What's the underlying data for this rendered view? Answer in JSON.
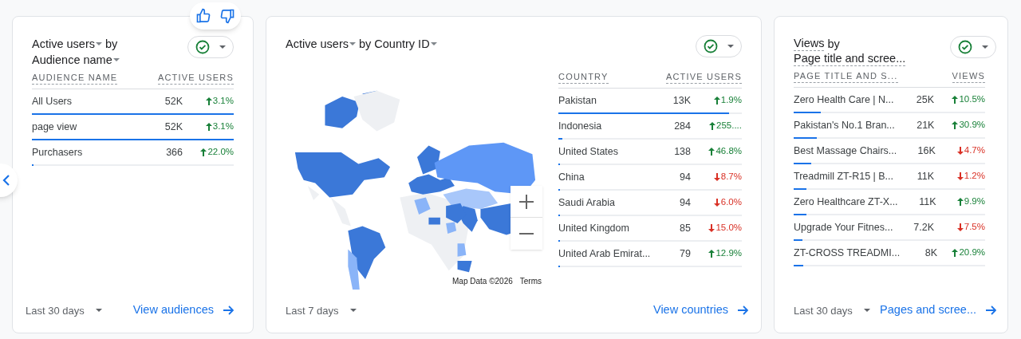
{
  "audience_card": {
    "title": [
      [
        {
          "text": "Active users",
          "kind": "dropdown"
        },
        {
          "text": "by",
          "kind": "plain"
        }
      ],
      [
        {
          "text": "Audience name",
          "kind": "dropdown"
        }
      ]
    ],
    "columns": [
      "AUDIENCE NAME",
      "ACTIVE USERS"
    ],
    "rows": [
      {
        "label": "All Users",
        "value": "52K",
        "change": "3.1%",
        "rising": true,
        "level": 1.0
      },
      {
        "label": "page view",
        "value": "52K",
        "change": "3.1%",
        "rising": true,
        "level": 1.0
      },
      {
        "label": "Purchasers",
        "value": "366",
        "change": "22.0%",
        "rising": true,
        "level": 0.008
      }
    ],
    "date_range": "Last 30 days",
    "link": "View audiences"
  },
  "country_card": {
    "title": [
      [
        {
          "text": "Active users",
          "kind": "dropdown"
        },
        {
          "text": "by",
          "kind": "plain"
        },
        {
          "text": "Country ID",
          "kind": "dropdown"
        }
      ]
    ],
    "map": {
      "attribution": "Map Data ©2026",
      "terms": "Terms"
    },
    "columns": [
      "COUNTRY",
      "ACTIVE USERS"
    ],
    "rows": [
      {
        "label": "Pakistan",
        "value": "13K",
        "change": "1.9%",
        "rising": true,
        "level": 0.93
      },
      {
        "label": "Indonesia",
        "value": "284",
        "change": "255....",
        "rising": true,
        "level": 0.02
      },
      {
        "label": "United States",
        "value": "138",
        "change": "46.8%",
        "rising": true,
        "level": 0.01
      },
      {
        "label": "China",
        "value": "94",
        "change": "8.7%",
        "rising": false,
        "level": 0.007
      },
      {
        "label": "Saudi Arabia",
        "value": "94",
        "change": "6.0%",
        "rising": false,
        "level": 0.007
      },
      {
        "label": "United Kingdom",
        "value": "85",
        "change": "15.0%",
        "rising": false,
        "level": 0.006
      },
      {
        "label": "United Arab Emirat...",
        "value": "79",
        "change": "12.9%",
        "rising": true,
        "level": 0.006
      }
    ],
    "date_range": "Last 7 days",
    "link": "View countries"
  },
  "pages_card": {
    "title": [
      [
        {
          "text": "Views",
          "kind": "dashed"
        },
        {
          "text": "by",
          "kind": "plain"
        }
      ],
      [
        {
          "text": "Page title and scree...",
          "kind": "dashed"
        }
      ]
    ],
    "columns": [
      "PAGE TITLE AND S...",
      "VIEWS"
    ],
    "rows": [
      {
        "label": "Zero Health Care | N...",
        "value": "25K",
        "change": "10.5%",
        "rising": true,
        "level": 0.14
      },
      {
        "label": "Pakistan's No.1 Bran...",
        "value": "21K",
        "change": "30.9%",
        "rising": true,
        "level": 0.12
      },
      {
        "label": "Best Massage Chairs...",
        "value": "16K",
        "change": "4.7%",
        "rising": false,
        "level": 0.09
      },
      {
        "label": "Treadmill ZT-R15 | B...",
        "value": "11K",
        "change": "1.2%",
        "rising": false,
        "level": 0.065
      },
      {
        "label": "Zero Healthcare ZT-X...",
        "value": "11K",
        "change": "9.9%",
        "rising": true,
        "level": 0.065
      },
      {
        "label": "Upgrade Your Fitnes...",
        "value": "7.2K",
        "change": "7.5%",
        "rising": false,
        "level": 0.045
      },
      {
        "label": "ZT-CROSS TREADMI...",
        "value": "8K",
        "change": "20.9%",
        "rising": true,
        "level": 0.05
      }
    ],
    "date_range": "Last 30 days",
    "link": "Pages and scree..."
  }
}
